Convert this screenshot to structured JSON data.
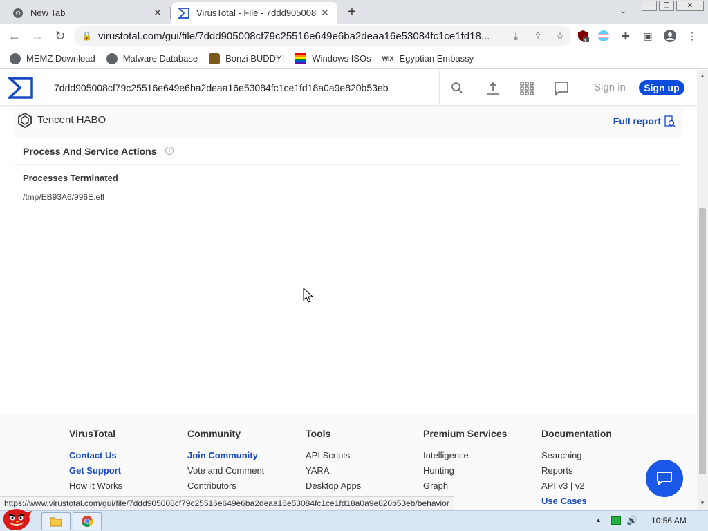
{
  "browser": {
    "tabs": [
      {
        "title": "New Tab",
        "icon": "chrome-icon",
        "active": false
      },
      {
        "title": "VirusTotal - File - 7ddd905008",
        "icon": "virustotal-icon",
        "active": true
      }
    ],
    "url": "virustotal.com/gui/file/7ddd905008cf79c25516e649e6ba2deaa16e53084fc1ce1fd18...",
    "status_url": "https://www.virustotal.com/gui/file/7ddd905008cf79c25516e649e6ba2deaa16e53084fc1ce1fd18a0a9e820b53eb/behavior",
    "extension_badge": "1",
    "bookmarks": [
      {
        "label": "MEMZ Download",
        "icon": "globe-icon"
      },
      {
        "label": "Malware Database",
        "icon": "globe-icon"
      },
      {
        "label": "Bonzi BUDDY!",
        "icon": "bonzi-icon"
      },
      {
        "label": "Windows ISOs",
        "icon": "rainbow-flag-icon"
      },
      {
        "label": "Egyptian Embassy",
        "icon": "wix-icon"
      }
    ]
  },
  "vt": {
    "search_value": "7ddd905008cf79c25516e649e6ba2deaa16e53084fc1ce1fd18a0a9e820b53eb",
    "signin": "Sign in",
    "signup": "Sign up",
    "sandbox_name": "Tencent HABO",
    "full_report": "Full report",
    "section_title": "Process And Service Actions",
    "subsection_title": "Processes Terminated",
    "terminated_process": "/tmp/EB93A6/996E.elf"
  },
  "footer": {
    "columns": [
      {
        "heading": "VirusTotal",
        "links": [
          {
            "label": "Contact Us",
            "highlight": true
          },
          {
            "label": "Get Support",
            "highlight": true
          },
          {
            "label": "How It Works",
            "highlight": false
          }
        ]
      },
      {
        "heading": "Community",
        "links": [
          {
            "label": "Join Community",
            "highlight": true
          },
          {
            "label": "Vote and Comment",
            "highlight": false
          },
          {
            "label": "Contributors",
            "highlight": false
          }
        ]
      },
      {
        "heading": "Tools",
        "links": [
          {
            "label": "API Scripts",
            "highlight": false
          },
          {
            "label": "YARA",
            "highlight": false
          },
          {
            "label": "Desktop Apps",
            "highlight": false
          }
        ]
      },
      {
        "heading": "Premium Services",
        "links": [
          {
            "label": "Intelligence",
            "highlight": false
          },
          {
            "label": "Hunting",
            "highlight": false
          },
          {
            "label": "Graph",
            "highlight": false
          }
        ]
      },
      {
        "heading": "Documentation",
        "links": [
          {
            "label": "Searching",
            "highlight": false
          },
          {
            "label": "Reports",
            "highlight": false
          },
          {
            "label": "API v3 | v2",
            "highlight": false
          },
          {
            "label": "Use Cases",
            "highlight": true
          }
        ]
      }
    ]
  },
  "taskbar": {
    "clock": "10:56 AM"
  },
  "colors": {
    "vt_blue": "#0b4dda",
    "link_blue": "#1849c4",
    "chat_blue": "#1a56e8"
  }
}
